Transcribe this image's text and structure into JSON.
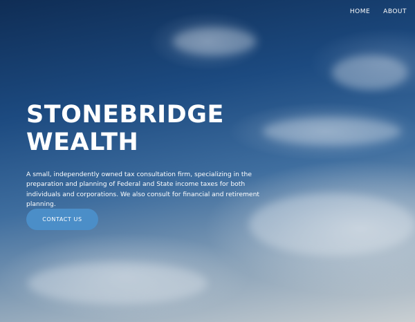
{
  "nav": {
    "items": [
      {
        "label": "HOME"
      },
      {
        "label": "ABOUT"
      }
    ]
  },
  "hero": {
    "title_line1": "STONEBRIDGE",
    "title_line2": "WEALTH",
    "description": "A small, independently owned tax consultation firm, specializing in the preparation and planning of Federal and State income taxes for both individuals and corporations. We also consult for financial and retirement planning.",
    "cta_label": "CONTACT US"
  },
  "colors": {
    "sky_top": "#0f2d55",
    "sky_mid": "#3f6e9f",
    "cta_background": "#4b8ec8",
    "text": "#ffffff"
  }
}
